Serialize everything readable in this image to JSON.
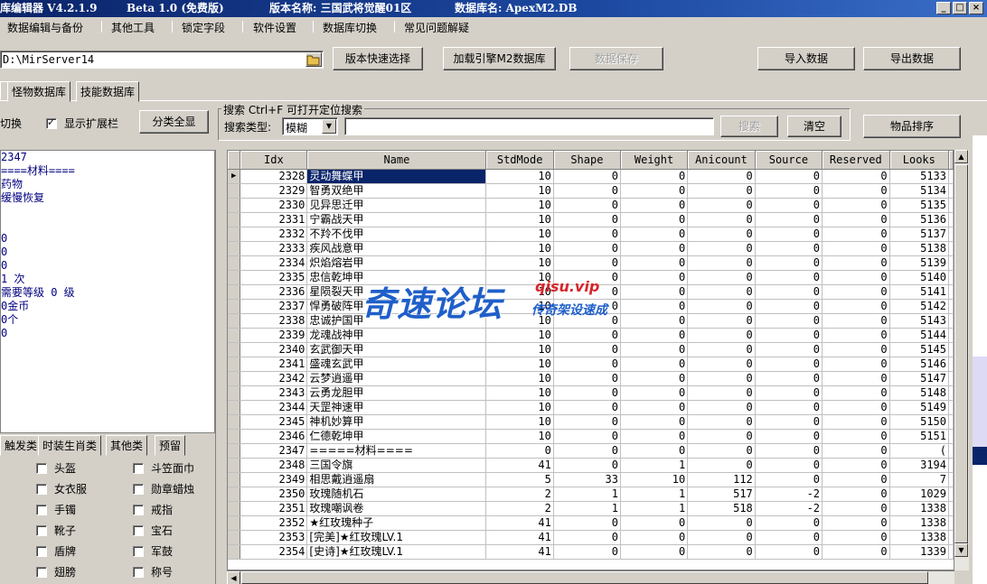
{
  "titlebar": {
    "app": "库编辑器 V4.2.1.9",
    "beta": "Beta 1.0 (免费版)",
    "version": "版本名称: 三国武将觉醒01区",
    "db": "数据库名: ApexM2.DB"
  },
  "menu": [
    "数据编辑与备份",
    "其他工具",
    "锁定字段",
    "软件设置",
    "数据库切换",
    "常见问题解疑"
  ],
  "toolbar": {
    "path": "D:\\MirServer14",
    "version_select": "版本快速选择",
    "load_engine": "加载引擎M2数据库",
    "save_data": "数据保存",
    "import": "导入数据",
    "export": "导出数据"
  },
  "tabs": [
    "怪物数据库",
    "技能数据库"
  ],
  "left": {
    "switch_label": "切换",
    "show_ext": "显示扩展栏",
    "category_all": "分类全显",
    "info_lines": [
      "2347",
      "====材料====",
      "药物",
      "缓慢恢复",
      "",
      "",
      "0",
      "0",
      "0",
      "1 次",
      "需要等级 0 级",
      "0金币",
      "0个",
      "0"
    ],
    "cat_tabs": [
      "触发类",
      "时装生肖类",
      "其他类",
      "预留"
    ],
    "checkboxes": [
      [
        "头盔",
        "斗笠面巾"
      ],
      [
        "女衣服",
        "勋章蜡烛"
      ],
      [
        "手镯",
        "戒指"
      ],
      [
        "靴子",
        "宝石"
      ],
      [
        "盾牌",
        "军鼓"
      ],
      [
        "翅膀",
        "称号"
      ]
    ]
  },
  "search": {
    "title": "搜索  Ctrl+F 可打开定位搜索",
    "type_label": "搜索类型:",
    "type_value": "模糊",
    "query": "",
    "search_btn": "搜索",
    "clear_btn": "清空",
    "sort_btn": "物品排序"
  },
  "grid": {
    "columns": [
      "Idx",
      "Name",
      "StdMode",
      "Shape",
      "Weight",
      "Anicount",
      "Source",
      "Reserved",
      "Looks"
    ],
    "selected_index": 0,
    "rows": [
      [
        "2328",
        "灵动舞蝶甲",
        "10",
        "0",
        "0",
        "0",
        "0",
        "0",
        "5133"
      ],
      [
        "2329",
        "智勇双绝甲",
        "10",
        "0",
        "0",
        "0",
        "0",
        "0",
        "5134"
      ],
      [
        "2330",
        "见异思迁甲",
        "10",
        "0",
        "0",
        "0",
        "0",
        "0",
        "5135"
      ],
      [
        "2331",
        "宁霸战天甲",
        "10",
        "0",
        "0",
        "0",
        "0",
        "0",
        "5136"
      ],
      [
        "2332",
        "不羚不伐甲",
        "10",
        "0",
        "0",
        "0",
        "0",
        "0",
        "5137"
      ],
      [
        "2333",
        "疾风战意甲",
        "10",
        "0",
        "0",
        "0",
        "0",
        "0",
        "5138"
      ],
      [
        "2334",
        "炽焰熔岩甲",
        "10",
        "0",
        "0",
        "0",
        "0",
        "0",
        "5139"
      ],
      [
        "2335",
        "忠信乾坤甲",
        "10",
        "0",
        "0",
        "0",
        "0",
        "0",
        "5140"
      ],
      [
        "2336",
        "星陨裂天甲",
        "10",
        "0",
        "0",
        "0",
        "0",
        "0",
        "5141"
      ],
      [
        "2337",
        "悍勇破阵甲",
        "10",
        "0",
        "0",
        "0",
        "0",
        "0",
        "5142"
      ],
      [
        "2338",
        "忠诚护国甲",
        "10",
        "0",
        "0",
        "0",
        "0",
        "0",
        "5143"
      ],
      [
        "2339",
        "龙魂战神甲",
        "10",
        "0",
        "0",
        "0",
        "0",
        "0",
        "5144"
      ],
      [
        "2340",
        "玄武御天甲",
        "10",
        "0",
        "0",
        "0",
        "0",
        "0",
        "5145"
      ],
      [
        "2341",
        "盛魂玄武甲",
        "10",
        "0",
        "0",
        "0",
        "0",
        "0",
        "5146"
      ],
      [
        "2342",
        "云梦逍遥甲",
        "10",
        "0",
        "0",
        "0",
        "0",
        "0",
        "5147"
      ],
      [
        "2343",
        "云勇龙胆甲",
        "10",
        "0",
        "0",
        "0",
        "0",
        "0",
        "5148"
      ],
      [
        "2344",
        "天罡神速甲",
        "10",
        "0",
        "0",
        "0",
        "0",
        "0",
        "5149"
      ],
      [
        "2345",
        "神机妙算甲",
        "10",
        "0",
        "0",
        "0",
        "0",
        "0",
        "5150"
      ],
      [
        "2346",
        "仁德乾坤甲",
        "10",
        "0",
        "0",
        "0",
        "0",
        "0",
        "5151"
      ],
      [
        "2347",
        "=====材料====",
        "0",
        "0",
        "0",
        "0",
        "0",
        "0",
        "("
      ],
      [
        "2348",
        "三国令旗",
        "41",
        "0",
        "1",
        "0",
        "0",
        "0",
        "3194"
      ],
      [
        "2349",
        "相思戴逍遥扇",
        "5",
        "33",
        "10",
        "112",
        "0",
        "0",
        "7"
      ],
      [
        "2350",
        "玫瑰随机石",
        "2",
        "1",
        "1",
        "517",
        "-2",
        "0",
        "1029"
      ],
      [
        "2351",
        "玫瑰嘲讽卷",
        "2",
        "1",
        "1",
        "518",
        "-2",
        "0",
        "1338"
      ],
      [
        "2352",
        "★红玫瑰种子",
        "41",
        "0",
        "0",
        "0",
        "0",
        "0",
        "1338"
      ],
      [
        "2353",
        "[完美]★红玫瑰LV.1",
        "41",
        "0",
        "0",
        "0",
        "0",
        "0",
        "1338"
      ],
      [
        "2354",
        "[史诗]★红玫瑰LV.1",
        "41",
        "0",
        "0",
        "0",
        "0",
        "0",
        "1339"
      ]
    ]
  },
  "watermark": {
    "main": "奇速论坛",
    "domain": "qisu.vip",
    "slogan": "传奇架设速成"
  }
}
